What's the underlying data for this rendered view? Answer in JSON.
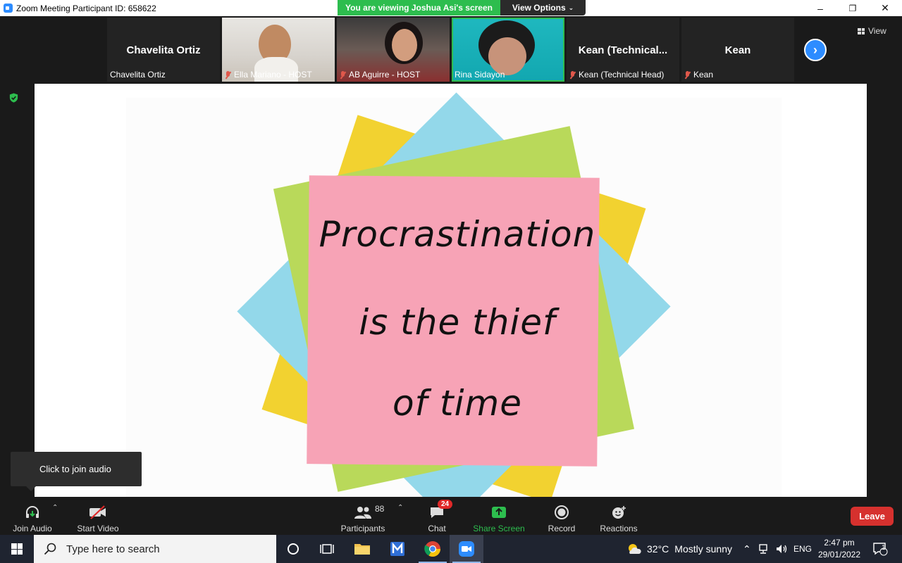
{
  "window": {
    "title": "Zoom Meeting Participant ID: 658622",
    "banner": "You are viewing Joshua Asi's screen",
    "view_options": "View Options"
  },
  "participants": [
    {
      "display": "Chavelita Ortiz",
      "label": "Chavelita Ortiz",
      "muted": false,
      "video": false
    },
    {
      "display": "",
      "label": "Ella Mariano - HOST",
      "muted": true,
      "video": true
    },
    {
      "display": "",
      "label": "AB Aguirre - HOST",
      "muted": true,
      "video": true
    },
    {
      "display": "",
      "label": "Rina Sidayon",
      "muted": false,
      "video": true,
      "active": true
    },
    {
      "display": "Kean (Technical...",
      "label": "Kean (Technical Head)",
      "muted": true,
      "video": false
    },
    {
      "display": "Kean",
      "label": "Kean",
      "muted": true,
      "video": false
    }
  ],
  "view_button": "View",
  "shared_content": {
    "lines": [
      "Procrastination",
      "is the thief",
      "of time"
    ]
  },
  "tooltip": "Click to join audio",
  "toolbar": {
    "join_audio": "Join Audio",
    "start_video": "Start Video",
    "participants": "Participants",
    "participants_count": "88",
    "chat": "Chat",
    "chat_badge": "24",
    "share_screen": "Share Screen",
    "record": "Record",
    "reactions": "Reactions",
    "leave": "Leave"
  },
  "taskbar": {
    "search_placeholder": "Type here to search",
    "temperature": "32°C",
    "weather": "Mostly sunny",
    "language": "ENG",
    "time": "2:47 pm",
    "date": "29/01/2022",
    "notification_count": "1"
  },
  "colors": {
    "banner_green": "#2dbd4e",
    "zoom_blue": "#2d8cff",
    "leave_red": "#d6312e",
    "note_pink": "#f7a3b6",
    "note_green": "#b9d95a",
    "note_yellow": "#f2d230",
    "note_blue": "#93d8ea"
  }
}
